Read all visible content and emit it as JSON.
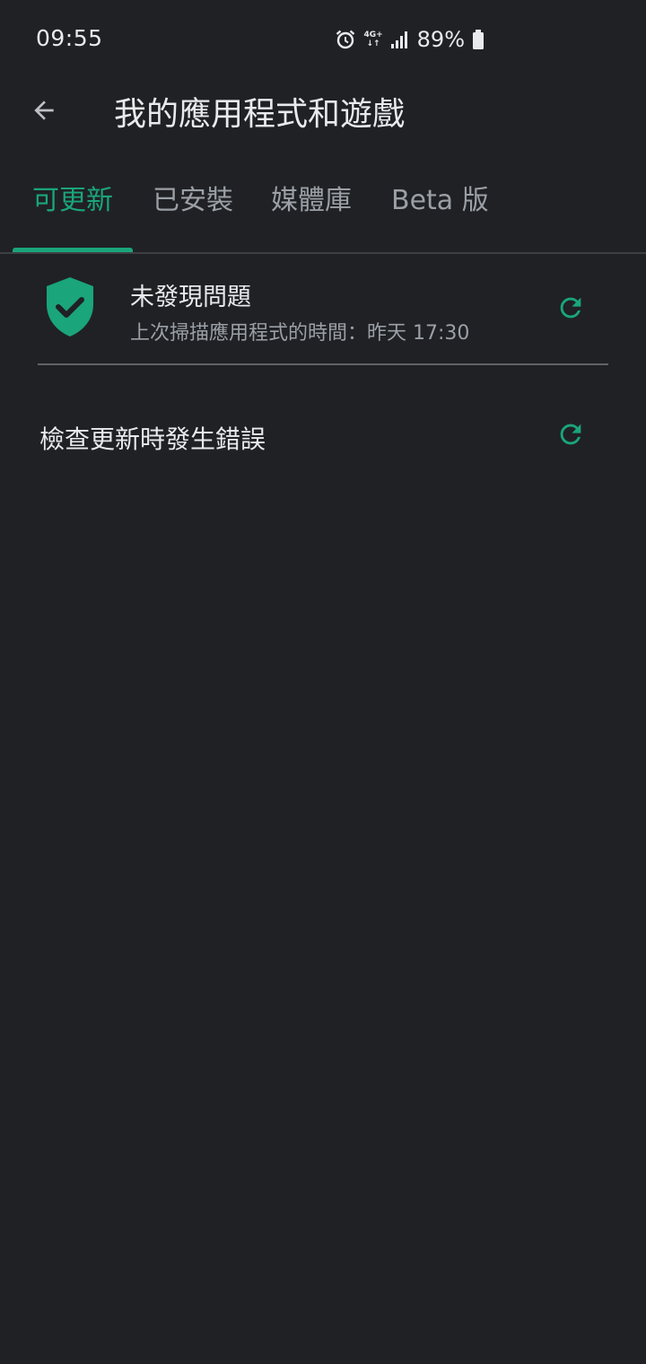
{
  "status_bar": {
    "time": "09:55",
    "network_label_top": "4G+",
    "network_label_bottom": "↓↑",
    "battery": "89%"
  },
  "app_bar": {
    "title": "我的應用程式和遊戲"
  },
  "tabs": [
    {
      "label": "可更新",
      "active": true
    },
    {
      "label": "已安裝",
      "active": false
    },
    {
      "label": "媒體庫",
      "active": false
    },
    {
      "label": "Beta 版",
      "active": false
    }
  ],
  "scan": {
    "title": "未發現問題",
    "subtitle": "上次掃描應用程式的時間：昨天 17:30"
  },
  "error": {
    "message": "檢查更新時發生錯誤"
  },
  "colors": {
    "background": "#202124",
    "accent": "#1aa57a",
    "text_primary": "#e8eaed",
    "text_secondary": "#9aa0a6"
  }
}
